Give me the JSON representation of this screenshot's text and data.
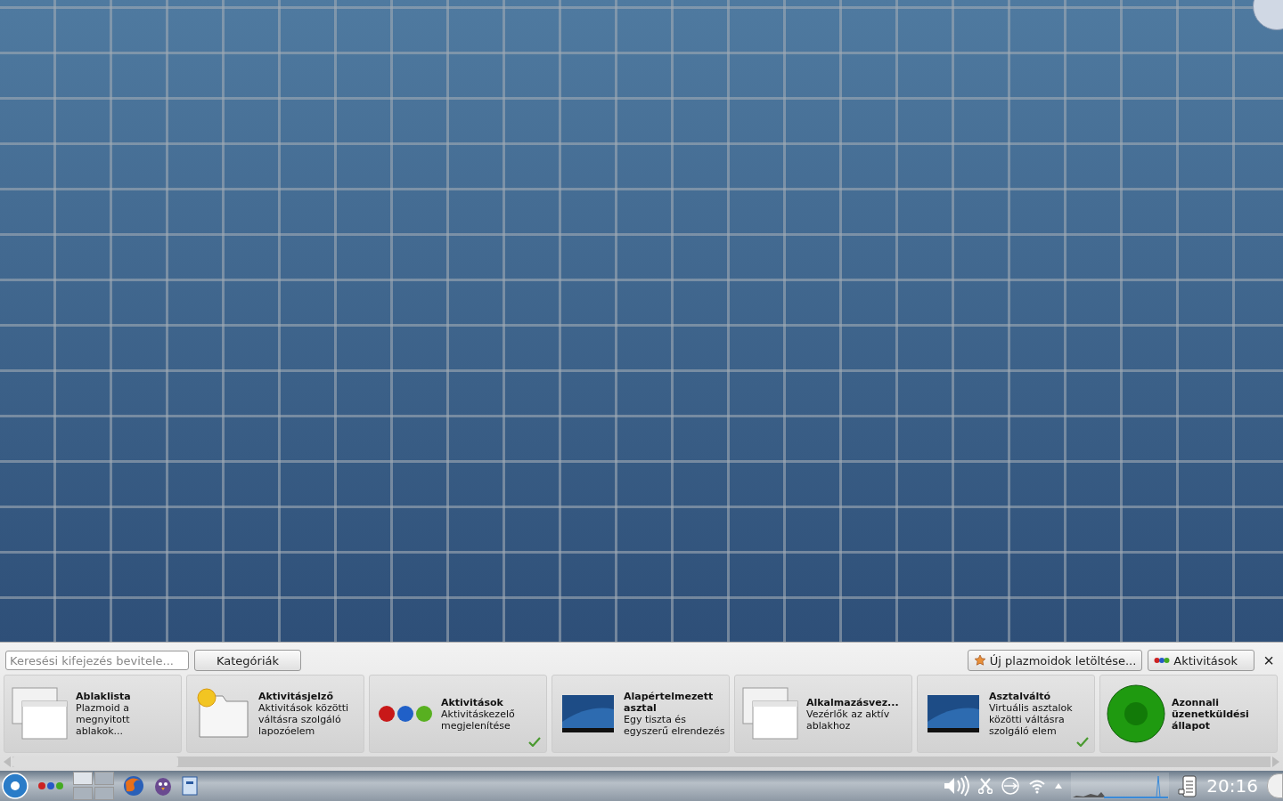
{
  "widget_explorer": {
    "search": {
      "placeholder": "Keresési kifejezés bevitele..."
    },
    "categories_button": "Kategóriák",
    "download_button": "Új plazmoidok letöltése...",
    "activities_button": "Aktivitások",
    "close": "×",
    "widgets": [
      {
        "kind": "windows",
        "name": "Ablaklista",
        "description": "Plazmoid a megnyitott ablakok...",
        "installed": false
      },
      {
        "kind": "sun",
        "name": "Aktivitásjelző",
        "description": "Aktivitások közötti váltásra szolgáló lapozóelem",
        "installed": false
      },
      {
        "kind": "dots",
        "name": "Aktivitások",
        "description": "Aktivitáskezelő megjelenítése",
        "installed": true
      },
      {
        "kind": "desktop",
        "name": "Alapértelmezett asztal",
        "description": "Egy tiszta és egyszerű elrendezés",
        "installed": false
      },
      {
        "kind": "windows",
        "name": "Alkalmazásvez...",
        "description": "Vezérlők az aktív ablakhoz",
        "installed": false
      },
      {
        "kind": "desktop",
        "name": "Asztalváltó",
        "description": "Virtuális asztalok közötti váltásra szolgáló elem",
        "installed": true
      },
      {
        "kind": "orb",
        "name": "Azonnali üzenetküldési állapot",
        "installed": false
      }
    ]
  },
  "taskbar": {
    "pager": [
      {
        "selected": true
      },
      {
        "selected": false
      },
      {
        "selected": false
      },
      {
        "selected": false
      }
    ],
    "clock": "20:16"
  }
}
